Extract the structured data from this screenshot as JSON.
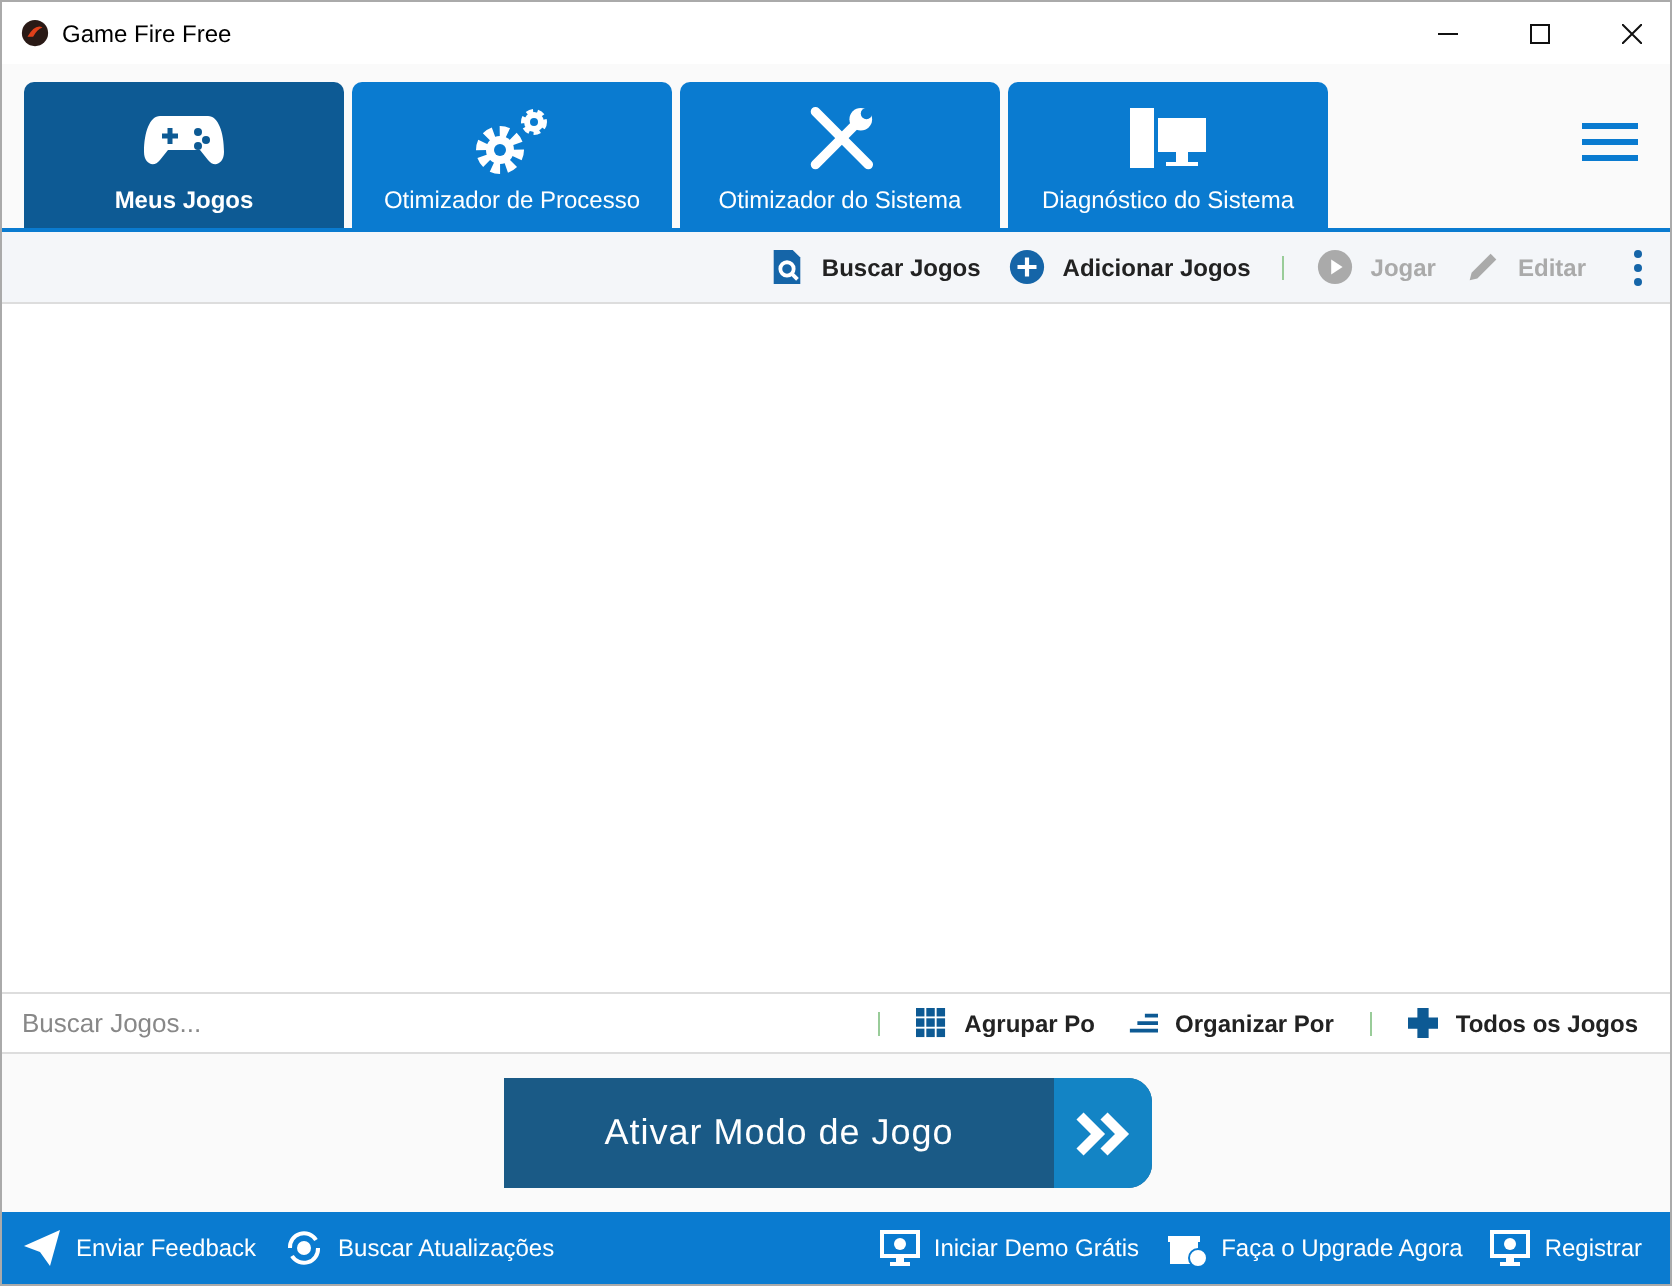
{
  "window": {
    "title": "Game Fire Free"
  },
  "tabs": [
    {
      "label": "Meus Jogos",
      "selected": true
    },
    {
      "label": "Otimizador de Processo",
      "selected": false
    },
    {
      "label": "Otimizador do Sistema",
      "selected": false
    },
    {
      "label": "Diagnóstico do Sistema",
      "selected": false
    }
  ],
  "toolbar": [
    {
      "label": "Buscar Jogos",
      "disabled": false
    },
    {
      "label": "Adicionar Jogos",
      "disabled": false
    },
    {
      "label": "Jogar",
      "disabled": true
    },
    {
      "label": "Editar",
      "disabled": true
    }
  ],
  "search": {
    "placeholder": "Buscar Jogos..."
  },
  "filters": [
    "Agrupar Po",
    "Organizar Por",
    "Todos os Jogos"
  ],
  "game_mode_button": "Ativar Modo de Jogo",
  "status_bar": {
    "left": [
      "Enviar Feedback",
      "Buscar Atualizações"
    ],
    "right": [
      "Iniciar Demo Grátis",
      "Faça o Upgrade Agora",
      "Registrar"
    ]
  }
}
